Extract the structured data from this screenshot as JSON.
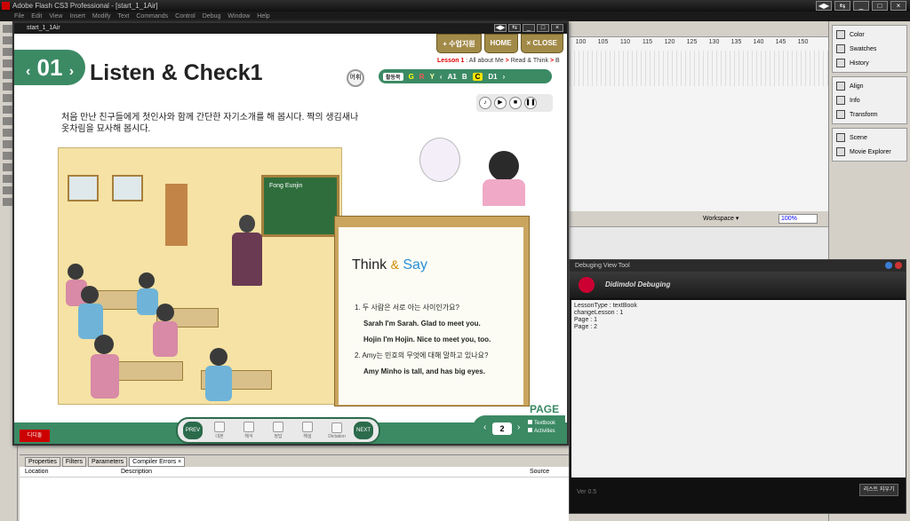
{
  "app": {
    "title": "Adobe Flash CS3 Professional - [start_1_1Air]",
    "menu": [
      "File",
      "Edit",
      "View",
      "Insert",
      "Modify",
      "Text",
      "Commands",
      "Control",
      "Debug",
      "Window",
      "Help"
    ]
  },
  "right_panel": {
    "group1": [
      "Color",
      "Swatches",
      "History"
    ],
    "group2": [
      "Align",
      "Info",
      "Transform"
    ],
    "group3": [
      "Scene",
      "Movie Explorer"
    ]
  },
  "timeline": {
    "ruler": [
      "100",
      "105",
      "110",
      "115",
      "120",
      "125",
      "130",
      "135",
      "140",
      "145",
      "150"
    ],
    "workspace_label": "Workspace ▾",
    "zoom": "100%"
  },
  "properties": {
    "tabs": [
      "Properties",
      "Filters",
      "Parameters",
      "Compiler Errors ×"
    ],
    "columns": [
      "Location",
      "Description",
      "Source"
    ]
  },
  "viewer": {
    "window_title": "start_1_1Air",
    "lesson_number": "01",
    "lesson_title": "Listen & Check1",
    "top_buttons": [
      "+ 수업지원",
      "HOME",
      "× CLOSE"
    ],
    "breadcrumb": {
      "lesson": "Lesson 1",
      "unit": " : All about Me",
      "arrow1": " > ",
      "section": "Read & Think",
      "arrow2": " > ",
      "part": " B"
    },
    "vocab_btn": "어휘",
    "activity_label": "활동북",
    "activity_grades": [
      "G",
      "R",
      "Y"
    ],
    "activity_items": [
      "A1",
      "B",
      "C",
      "D1"
    ],
    "instruction": "처음 만난 친구들에게 첫인사와 함께 간단한 자기소개를 해 봅시다. 짝의 생김새나 옷차림을 묘사해 봅시다.",
    "board_text": "Fong Eunjin",
    "think": "Think",
    "amp": "&",
    "say": "Say",
    "q1": "1. 두 사람은 서로 아는 사이인가요?",
    "a1a": "Sarah I'm Sarah. Glad to meet you.",
    "a1b": "Hojin I'm Hojin. Nice to meet you, too.",
    "q2": "2. Amy는 민호의 무엇에 대해 말하고 있나요?",
    "a2": "Amy Minho is tall, and has big eyes.",
    "nav": {
      "prev": "PREV",
      "next": "NEXT",
      "items": [
        "대본",
        "해석",
        "정답",
        "해설",
        "Dictation"
      ]
    },
    "page": {
      "label": "PAGE",
      "number": "2",
      "opt1": "Textbook",
      "opt2": "Activities"
    },
    "logo": "디디돌"
  },
  "debug": {
    "title": "Debuging View Tool",
    "header": "Didimdol Debuging",
    "log": [
      "LessonType : textBook",
      "changeLesson : 1",
      "Page : 1",
      "Page : 2"
    ],
    "version": "Ver 0.5",
    "clear_btn": "리스트 지우기"
  }
}
